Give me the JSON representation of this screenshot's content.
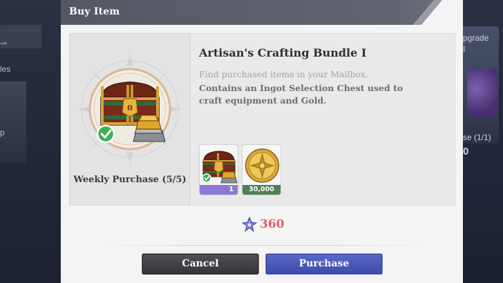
{
  "dialog": {
    "title": "Buy Item",
    "item_name": "Artisan's Crafting Bundle I",
    "mail_note": "Find purchased items in your Mailbox.",
    "description": "Contains an Ingot Selection Chest used to craft equipment and Gold.",
    "weekly_limit": "Weekly Purchase (5/5)",
    "rewards": [
      {
        "icon": "chest-icon",
        "quantity": "1"
      },
      {
        "icon": "gold-coin-icon",
        "quantity": "30,000"
      }
    ],
    "price": {
      "icon": "crystal-icon",
      "amount": "360"
    },
    "buttons": {
      "cancel": "Cancel",
      "purchase": "Purchase"
    }
  },
  "background": {
    "left_fragments": [
      "les",
      "p"
    ],
    "right_fragments": [
      "pgrade",
      "I",
      "se (1/1)",
      "0"
    ]
  },
  "colors": {
    "header": "#5c5f68",
    "price": "#e0606a",
    "purchase_button": "#4a57b8",
    "cancel_button": "#3f3f45",
    "reward_chest_band": "#8f79d4",
    "reward_gold_band": "#4f7f55"
  }
}
